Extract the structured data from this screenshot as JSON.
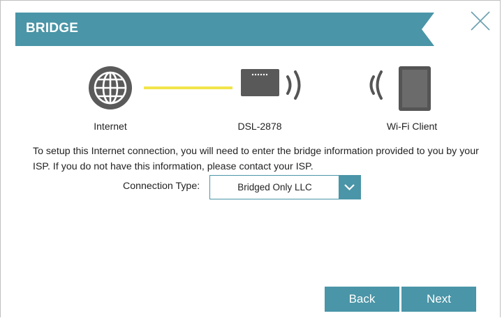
{
  "banner": {
    "title": "BRIDGE",
    "color": "#4a95a7"
  },
  "diagram": {
    "internet_label": "Internet",
    "device_label": "DSL-2878",
    "client_label": "Wi-Fi Client",
    "link_color": "#f2e44a",
    "device_color": "#555555"
  },
  "description": "To setup this Internet connection, you will need to enter the bridge information provided to you by your ISP. If you do not have this information, please contact your ISP.",
  "connection": {
    "label": "Connection Type:",
    "selected": "Bridged Only LLC"
  },
  "buttons": {
    "back": "Back",
    "next": "Next"
  },
  "icons": {
    "close": "close-icon",
    "globe": "globe-icon",
    "router": "router-icon",
    "tablet": "tablet-icon",
    "dropdown": "chevron-down-icon"
  }
}
